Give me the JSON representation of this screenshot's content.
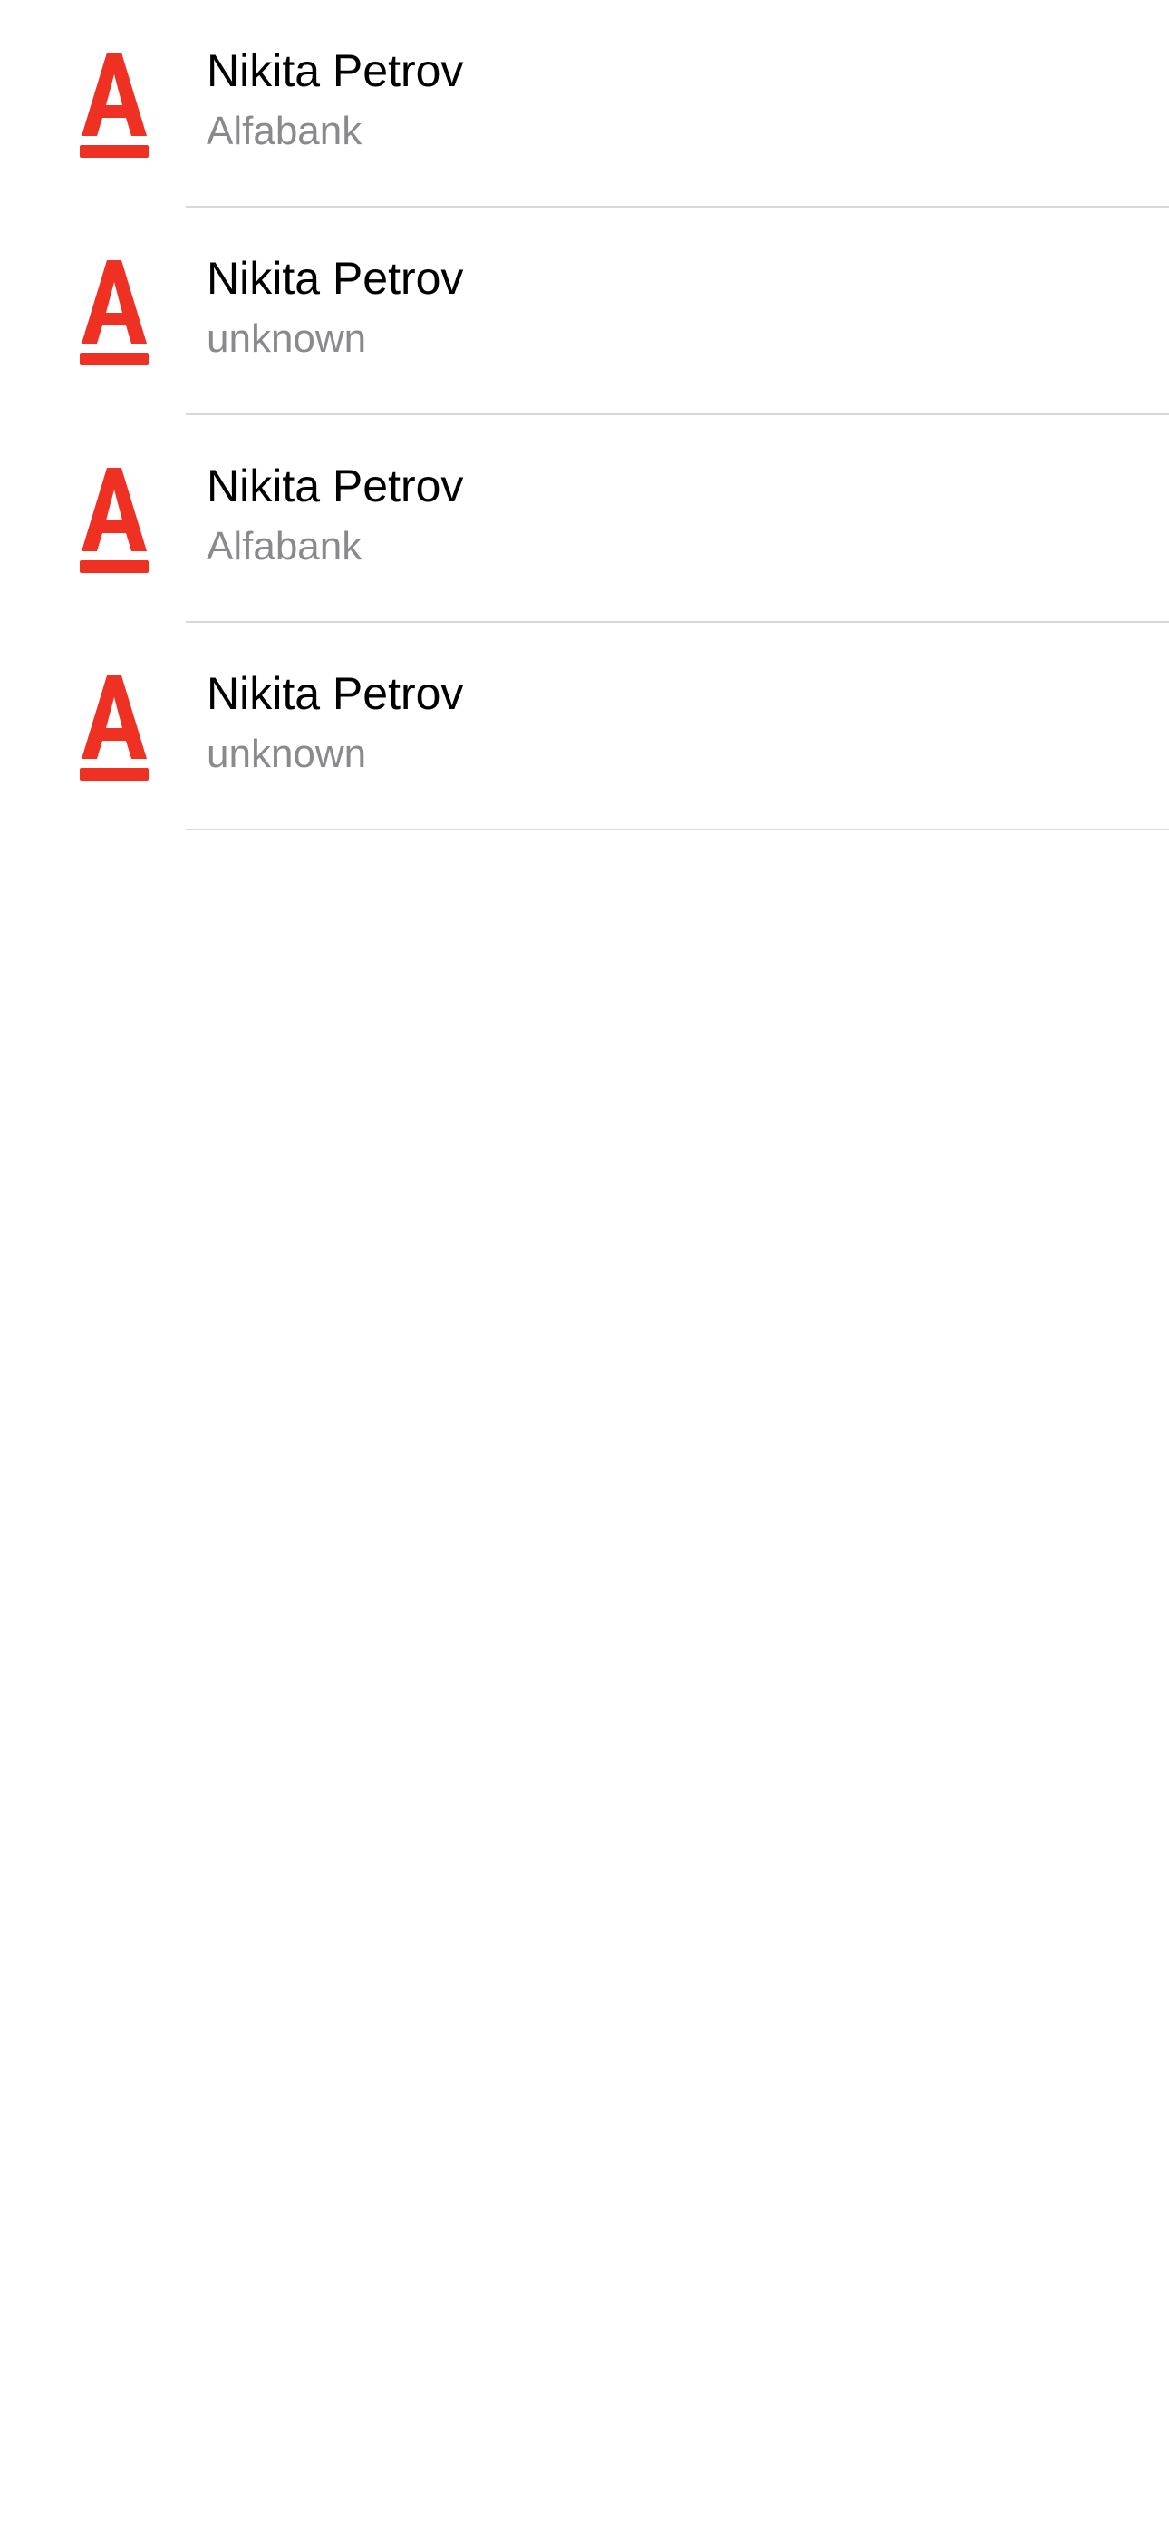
{
  "accounts": [
    {
      "name": "Nikita Petrov",
      "bank": "Alfabank",
      "icon": "alfabank-logo-icon"
    },
    {
      "name": "Nikita Petrov",
      "bank": "unknown",
      "icon": "alfabank-logo-icon"
    },
    {
      "name": "Nikita Petrov",
      "bank": "Alfabank",
      "icon": "alfabank-logo-icon"
    },
    {
      "name": "Nikita Petrov",
      "bank": "unknown",
      "icon": "alfabank-logo-icon"
    }
  ],
  "colors": {
    "brand": "#ef3124",
    "title": "#000000",
    "subtitle": "#8a8a8e",
    "divider": "#d9d9dc",
    "background": "#ffffff"
  }
}
